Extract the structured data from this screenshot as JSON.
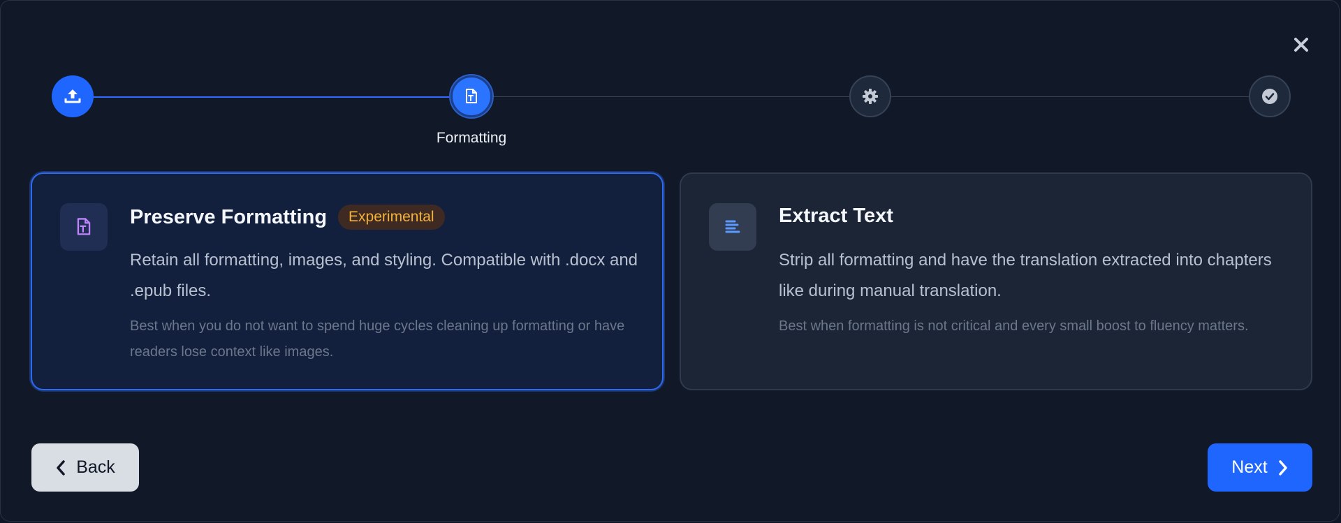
{
  "close": {
    "icon": "close-icon"
  },
  "stepper": {
    "steps": [
      {
        "icon": "upload-icon",
        "status": "completed"
      },
      {
        "icon": "file-format-icon",
        "status": "active",
        "label": "Formatting"
      },
      {
        "icon": "gear-icon",
        "status": "upcoming"
      },
      {
        "icon": "check-circle-icon",
        "status": "upcoming"
      }
    ]
  },
  "options": [
    {
      "icon": "file-format-icon",
      "title": "Preserve Formatting",
      "badge": "Experimental",
      "description": "Retain all formatting, images, and styling. Compatible with .docx and .epub files.",
      "note": "Best when you do not want to spend huge cycles cleaning up formatting or have readers lose context like images.",
      "selected": true
    },
    {
      "icon": "align-left-icon",
      "title": "Extract Text",
      "description": "Strip all formatting and have the translation extracted into chapters like during manual translation.",
      "note": "Best when formatting is not critical and every small boost to fluency matters.",
      "selected": false
    }
  ],
  "footer": {
    "back_label": "Back",
    "next_label": "Next"
  },
  "colors": {
    "accent": "#1f66ff",
    "badge_text": "#f3b23a",
    "background": "#111828"
  }
}
